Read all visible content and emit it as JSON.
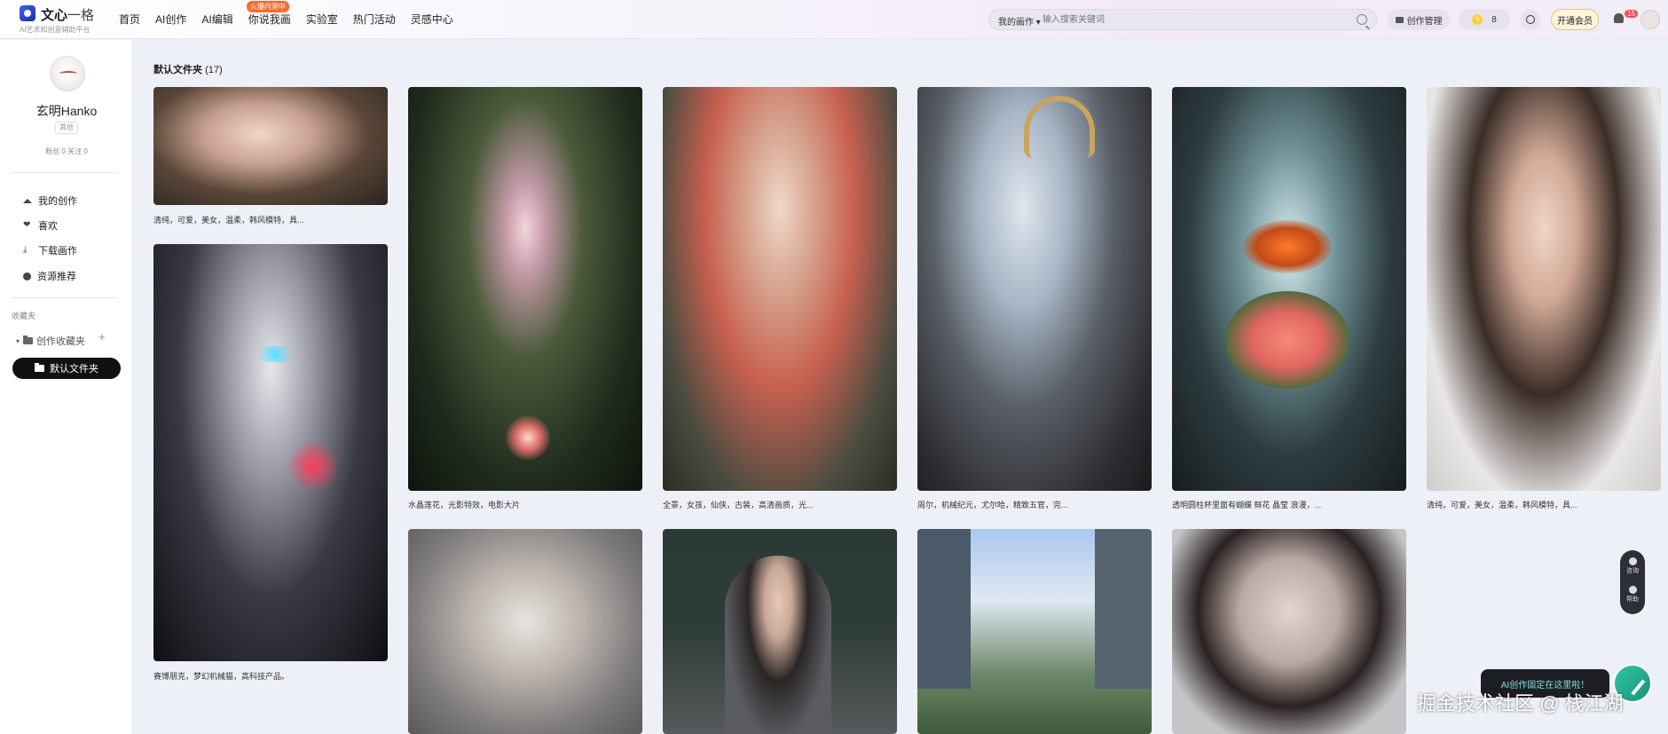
{
  "logo": {
    "brand": "文心",
    "brand_suffix": "一格",
    "subtitle": "AI艺术和创意辅助平台"
  },
  "nav": {
    "items": [
      "首页",
      "AI创作",
      "AI编辑",
      "你说我画",
      "实验室",
      "热门活动",
      "灵感中心"
    ],
    "badge": "火爆内测中"
  },
  "search": {
    "type_label": "我的画作 ▾",
    "placeholder": "输入搜索关键词"
  },
  "header": {
    "manage_label": "创作管理",
    "energy_count": "8",
    "vip_label": "开通会员",
    "notify_count": "15"
  },
  "user": {
    "name": "玄明Hanko",
    "role": "其他",
    "stats": "粉丝 0   关注 0"
  },
  "sidebar": {
    "items": [
      "我的创作",
      "喜欢",
      "下载画作",
      "资源推荐"
    ],
    "section_label": "收藏夹",
    "folder_group": "创作收藏夹",
    "active_folder": "默认文件夹"
  },
  "content": {
    "title": "默认文件夹",
    "count": "(17)"
  },
  "cards": [
    {
      "caption": "清纯，可爱，美女，温柔，韩风模特，具..."
    },
    {
      "caption": "赛博朋克，梦幻机械猫，高科技产品。"
    },
    {
      "caption": "水晶莲花，光影特效，电影大片"
    },
    {
      "caption": "全景，女孩，仙侠，古装，高清画质，光..."
    },
    {
      "caption": "周尔，机械纪元，尤尔哈，精致五官，完..."
    },
    {
      "caption": "透明圆柱杯里面有蝴蝶 鲜花 晶莹 浪漫，..."
    },
    {
      "caption": "清纯，可爱，美女，温柔，韩风模特，具..."
    }
  ],
  "floating": {
    "chat": "咨询",
    "help": "帮助"
  },
  "promo": "AI创作固定在这里啦！",
  "watermark": "掘金技术社区 @ 栈江湖",
  "colors": {
    "accent": "#111111",
    "badge": "#ff6a2b",
    "fab": "#2cc7a2"
  }
}
